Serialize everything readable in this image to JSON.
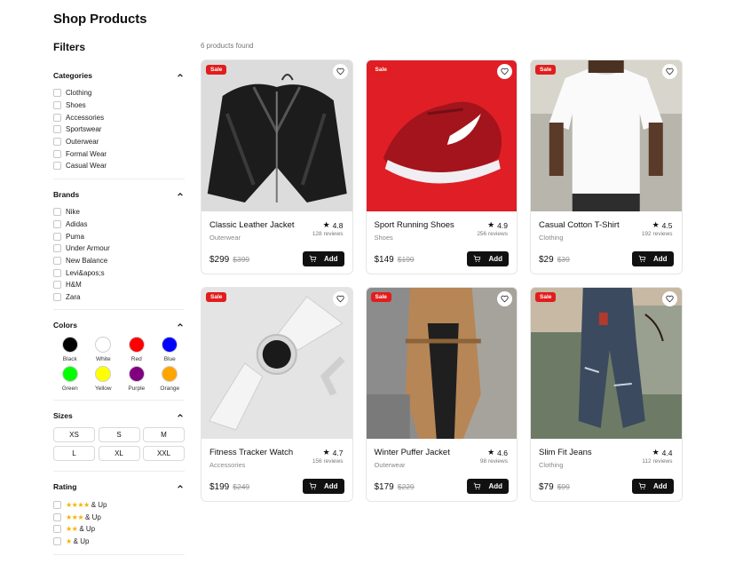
{
  "page": {
    "title": "Shop Products"
  },
  "filters": {
    "title": "Filters",
    "categories": {
      "title": "Categories",
      "items": [
        "Clothing",
        "Shoes",
        "Accessories",
        "Sportswear",
        "Outerwear",
        "Formal Wear",
        "Casual Wear"
      ]
    },
    "brands": {
      "title": "Brands",
      "items": [
        "Nike",
        "Adidas",
        "Puma",
        "Under Armour",
        "New Balance",
        "Levi&apos;s",
        "H&M",
        "Zara"
      ]
    },
    "colors": {
      "title": "Colors",
      "items": [
        {
          "name": "Black",
          "hex": "#000000"
        },
        {
          "name": "White",
          "hex": "#ffffff"
        },
        {
          "name": "Red",
          "hex": "#ff0000"
        },
        {
          "name": "Blue",
          "hex": "#0000ff"
        },
        {
          "name": "Green",
          "hex": "#00ff00"
        },
        {
          "name": "Yellow",
          "hex": "#ffff00"
        },
        {
          "name": "Purple",
          "hex": "#800080"
        },
        {
          "name": "Orange",
          "hex": "#ffa500"
        }
      ]
    },
    "sizes": {
      "title": "Sizes",
      "items": [
        "XS",
        "S",
        "M",
        "L",
        "XL",
        "XXL"
      ]
    },
    "rating": {
      "title": "Rating",
      "items": [
        {
          "stars": "★★★★",
          "label": "& Up"
        },
        {
          "stars": "★★★",
          "label": "& Up"
        },
        {
          "stars": "★★",
          "label": "& Up"
        },
        {
          "stars": "★",
          "label": "& Up"
        }
      ]
    }
  },
  "results": {
    "count_text": "6 products found"
  },
  "products": [
    {
      "name": "Classic Leather Jacket",
      "category": "Outerwear",
      "rating": "4.8",
      "reviews": "128 reviews",
      "price": "$299",
      "old_price": "$399",
      "badge": "Sale",
      "add_label": "Add",
      "image_icon": "leather-jacket"
    },
    {
      "name": "Sport Running Shoes",
      "category": "Shoes",
      "rating": "4.9",
      "reviews": "256 reviews",
      "price": "$149",
      "old_price": "$199",
      "badge": "Sale",
      "add_label": "Add",
      "image_icon": "running-shoe"
    },
    {
      "name": "Casual Cotton T-Shirt",
      "category": "Clothing",
      "rating": "4.5",
      "reviews": "192 reviews",
      "price": "$29",
      "old_price": "$39",
      "badge": "Sale",
      "add_label": "Add",
      "image_icon": "t-shirt"
    },
    {
      "name": "Fitness Tracker Watch",
      "category": "Accessories",
      "rating": "4.7",
      "reviews": "156 reviews",
      "price": "$199",
      "old_price": "$249",
      "badge": "Sale",
      "add_label": "Add",
      "image_icon": "smart-watch"
    },
    {
      "name": "Winter Puffer Jacket",
      "category": "Outerwear",
      "rating": "4.6",
      "reviews": "98 reviews",
      "price": "$179",
      "old_price": "$229",
      "badge": "Sale",
      "add_label": "Add",
      "image_icon": "coat"
    },
    {
      "name": "Slim Fit Jeans",
      "category": "Clothing",
      "rating": "4.4",
      "reviews": "112 reviews",
      "price": "$79",
      "old_price": "$99",
      "badge": "Sale",
      "add_label": "Add",
      "image_icon": "jeans"
    }
  ],
  "icons": {
    "collapse": "chevron-up-icon",
    "favorite": "heart-icon",
    "cart": "cart-icon",
    "rating": "star-icon"
  },
  "colors_theme": {
    "sale_badge": "#e11d1d",
    "button": "#111111",
    "star": "#f5b301"
  }
}
